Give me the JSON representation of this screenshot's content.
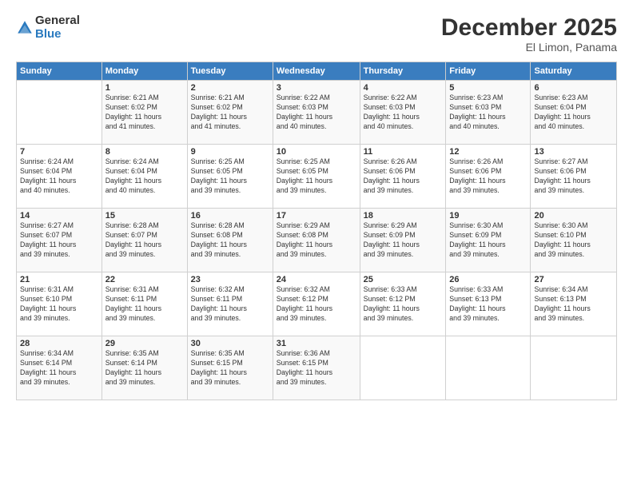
{
  "logo": {
    "general": "General",
    "blue": "Blue"
  },
  "header": {
    "month": "December 2025",
    "location": "El Limon, Panama"
  },
  "days_of_week": [
    "Sunday",
    "Monday",
    "Tuesday",
    "Wednesday",
    "Thursday",
    "Friday",
    "Saturday"
  ],
  "weeks": [
    [
      {
        "day": "",
        "info": ""
      },
      {
        "day": "1",
        "info": "Sunrise: 6:21 AM\nSunset: 6:02 PM\nDaylight: 11 hours\nand 41 minutes."
      },
      {
        "day": "2",
        "info": "Sunrise: 6:21 AM\nSunset: 6:02 PM\nDaylight: 11 hours\nand 41 minutes."
      },
      {
        "day": "3",
        "info": "Sunrise: 6:22 AM\nSunset: 6:03 PM\nDaylight: 11 hours\nand 40 minutes."
      },
      {
        "day": "4",
        "info": "Sunrise: 6:22 AM\nSunset: 6:03 PM\nDaylight: 11 hours\nand 40 minutes."
      },
      {
        "day": "5",
        "info": "Sunrise: 6:23 AM\nSunset: 6:03 PM\nDaylight: 11 hours\nand 40 minutes."
      },
      {
        "day": "6",
        "info": "Sunrise: 6:23 AM\nSunset: 6:04 PM\nDaylight: 11 hours\nand 40 minutes."
      }
    ],
    [
      {
        "day": "7",
        "info": "Sunrise: 6:24 AM\nSunset: 6:04 PM\nDaylight: 11 hours\nand 40 minutes."
      },
      {
        "day": "8",
        "info": "Sunrise: 6:24 AM\nSunset: 6:04 PM\nDaylight: 11 hours\nand 40 minutes."
      },
      {
        "day": "9",
        "info": "Sunrise: 6:25 AM\nSunset: 6:05 PM\nDaylight: 11 hours\nand 39 minutes."
      },
      {
        "day": "10",
        "info": "Sunrise: 6:25 AM\nSunset: 6:05 PM\nDaylight: 11 hours\nand 39 minutes."
      },
      {
        "day": "11",
        "info": "Sunrise: 6:26 AM\nSunset: 6:06 PM\nDaylight: 11 hours\nand 39 minutes."
      },
      {
        "day": "12",
        "info": "Sunrise: 6:26 AM\nSunset: 6:06 PM\nDaylight: 11 hours\nand 39 minutes."
      },
      {
        "day": "13",
        "info": "Sunrise: 6:27 AM\nSunset: 6:06 PM\nDaylight: 11 hours\nand 39 minutes."
      }
    ],
    [
      {
        "day": "14",
        "info": "Sunrise: 6:27 AM\nSunset: 6:07 PM\nDaylight: 11 hours\nand 39 minutes."
      },
      {
        "day": "15",
        "info": "Sunrise: 6:28 AM\nSunset: 6:07 PM\nDaylight: 11 hours\nand 39 minutes."
      },
      {
        "day": "16",
        "info": "Sunrise: 6:28 AM\nSunset: 6:08 PM\nDaylight: 11 hours\nand 39 minutes."
      },
      {
        "day": "17",
        "info": "Sunrise: 6:29 AM\nSunset: 6:08 PM\nDaylight: 11 hours\nand 39 minutes."
      },
      {
        "day": "18",
        "info": "Sunrise: 6:29 AM\nSunset: 6:09 PM\nDaylight: 11 hours\nand 39 minutes."
      },
      {
        "day": "19",
        "info": "Sunrise: 6:30 AM\nSunset: 6:09 PM\nDaylight: 11 hours\nand 39 minutes."
      },
      {
        "day": "20",
        "info": "Sunrise: 6:30 AM\nSunset: 6:10 PM\nDaylight: 11 hours\nand 39 minutes."
      }
    ],
    [
      {
        "day": "21",
        "info": "Sunrise: 6:31 AM\nSunset: 6:10 PM\nDaylight: 11 hours\nand 39 minutes."
      },
      {
        "day": "22",
        "info": "Sunrise: 6:31 AM\nSunset: 6:11 PM\nDaylight: 11 hours\nand 39 minutes."
      },
      {
        "day": "23",
        "info": "Sunrise: 6:32 AM\nSunset: 6:11 PM\nDaylight: 11 hours\nand 39 minutes."
      },
      {
        "day": "24",
        "info": "Sunrise: 6:32 AM\nSunset: 6:12 PM\nDaylight: 11 hours\nand 39 minutes."
      },
      {
        "day": "25",
        "info": "Sunrise: 6:33 AM\nSunset: 6:12 PM\nDaylight: 11 hours\nand 39 minutes."
      },
      {
        "day": "26",
        "info": "Sunrise: 6:33 AM\nSunset: 6:13 PM\nDaylight: 11 hours\nand 39 minutes."
      },
      {
        "day": "27",
        "info": "Sunrise: 6:34 AM\nSunset: 6:13 PM\nDaylight: 11 hours\nand 39 minutes."
      }
    ],
    [
      {
        "day": "28",
        "info": "Sunrise: 6:34 AM\nSunset: 6:14 PM\nDaylight: 11 hours\nand 39 minutes."
      },
      {
        "day": "29",
        "info": "Sunrise: 6:35 AM\nSunset: 6:14 PM\nDaylight: 11 hours\nand 39 minutes."
      },
      {
        "day": "30",
        "info": "Sunrise: 6:35 AM\nSunset: 6:15 PM\nDaylight: 11 hours\nand 39 minutes."
      },
      {
        "day": "31",
        "info": "Sunrise: 6:36 AM\nSunset: 6:15 PM\nDaylight: 11 hours\nand 39 minutes."
      },
      {
        "day": "",
        "info": ""
      },
      {
        "day": "",
        "info": ""
      },
      {
        "day": "",
        "info": ""
      }
    ]
  ]
}
